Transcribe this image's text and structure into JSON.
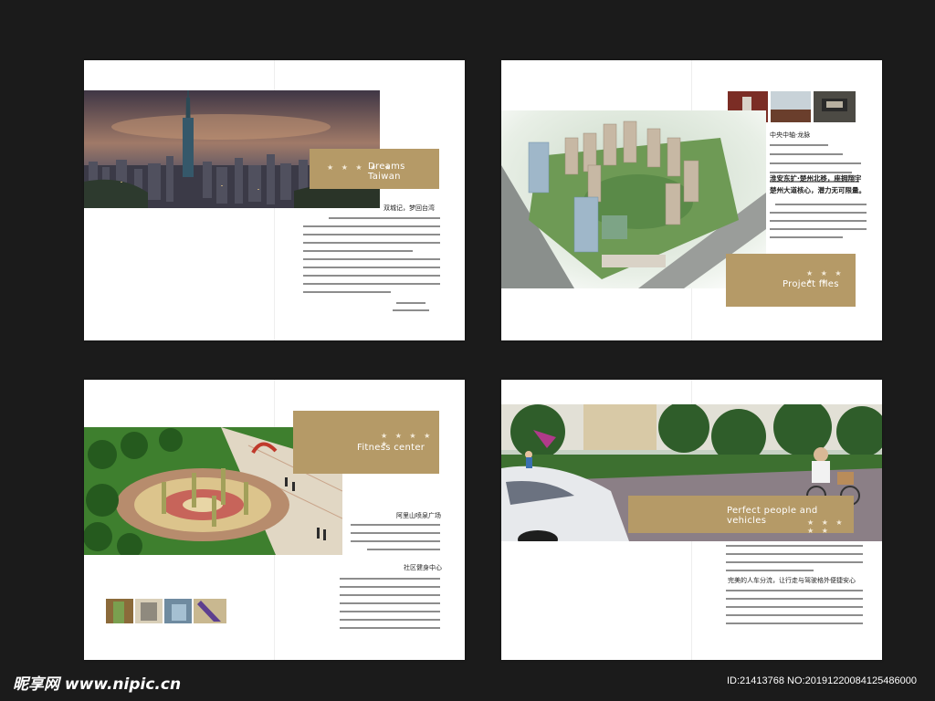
{
  "pages": {
    "taiwan": {
      "stars": "★ ★ ★ ★ ★",
      "box_title": "Dreams Taiwan",
      "heading": "双城记，梦回台湾"
    },
    "project": {
      "heading": "中央中轴·龙脉",
      "tagline_1": "淮安东扩·楚州北移，座拥翔宇",
      "tagline_2": "楚州大道核心，潜力无可限量。",
      "stars": "★ ★ ★ ★ ★",
      "box_title": "Project files"
    },
    "fitness": {
      "stars": "★ ★ ★ ★ ★",
      "box_title": "Fitness center",
      "heading_1": "阿里山喷泉广场",
      "heading_2": "社区健身中心"
    },
    "vehicles": {
      "box_title": "Perfect people and vehicles",
      "stars": "★ ★ ★ ★ ★",
      "heading": "完美的人车分流，让行走与驾驶格外便捷安心"
    }
  },
  "watermark": {
    "site": "昵享网 www.nipic.cn",
    "id": "ID:21413768 NO:20191220084125486000"
  },
  "colors": {
    "gold": "#b59a67",
    "background": "#1b1b1b"
  }
}
